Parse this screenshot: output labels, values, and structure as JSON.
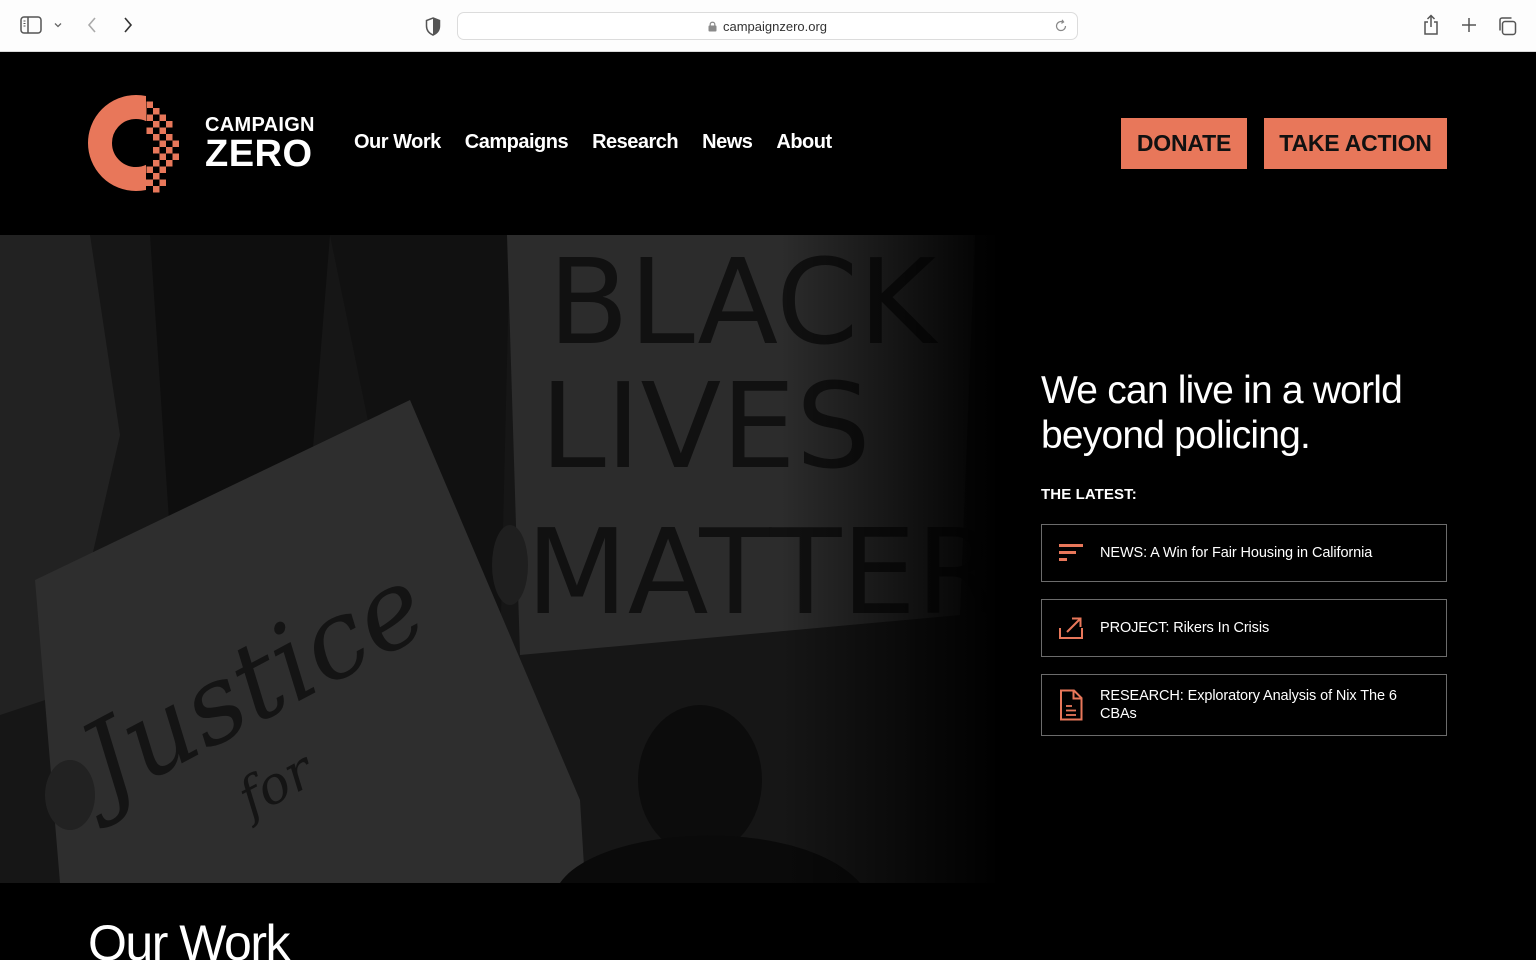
{
  "browser": {
    "url": "campaignzero.org",
    "icons": {
      "sidebar": "sidebar-icon",
      "sidebar_menu": "chevron-down-icon",
      "back": "chevron-left-icon",
      "forward": "chevron-right-icon",
      "privacy": "shield-icon",
      "lock": "lock-icon",
      "reload": "reload-icon",
      "share": "share-icon",
      "new_tab": "plus-icon",
      "tab_overview": "tabs-icon"
    }
  },
  "site": {
    "brand": {
      "line1": "CAMPAIGN",
      "line2": "ZERO",
      "accent_color": "#e8775a"
    },
    "nav": [
      {
        "label": "Our Work"
      },
      {
        "label": "Campaigns"
      },
      {
        "label": "Research"
      },
      {
        "label": "News"
      },
      {
        "label": "About"
      }
    ],
    "cta": {
      "donate": "DONATE",
      "take_action": "TAKE ACTION"
    },
    "hero": {
      "image_alt": "Protesters holding signs reading 'Black Lives Matter' and 'Justice for'",
      "sign_text_1": "BLACK LIVES MATTER",
      "sign_text_2": "Justice for",
      "headline": "We can live in a world beyond policing.",
      "latest_label": "THE LATEST:",
      "latest": [
        {
          "icon": "news-lines-icon",
          "text": "NEWS: A Win for Fair Housing in California"
        },
        {
          "icon": "external-link-icon",
          "text": "PROJECT: Rikers In Crisis"
        },
        {
          "icon": "document-icon",
          "text": "RESEARCH: Exploratory Analysis of Nix The 6 CBAs"
        }
      ]
    },
    "sections": {
      "our_work_title": "Our Work"
    }
  }
}
